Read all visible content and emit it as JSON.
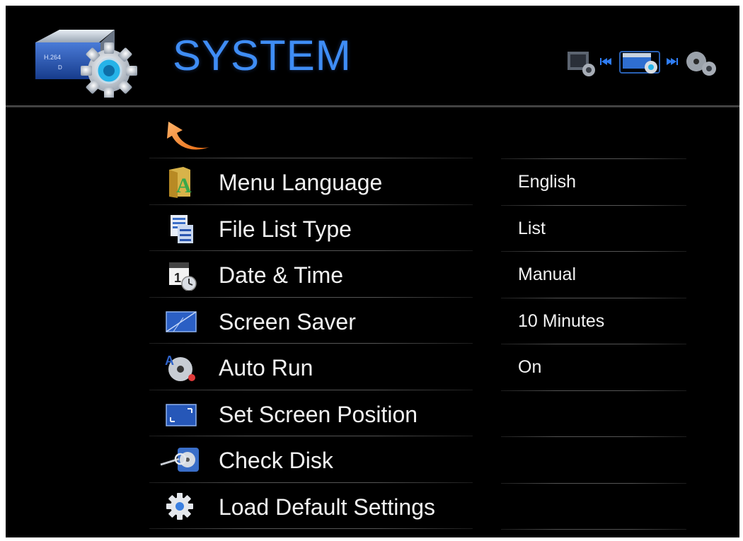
{
  "header": {
    "title": "SYSTEM",
    "app_icon": "system-settings-icon",
    "nav_icons": [
      "video-settings-icon",
      "prev-icon",
      "system-icon",
      "next-icon",
      "disc-settings-icon"
    ]
  },
  "back_icon": "back-arrow-icon",
  "colors": {
    "title": "#3f8df5",
    "background": "#000000",
    "text": "#f2f2f2"
  },
  "menu": {
    "items": [
      {
        "label": "Menu Language",
        "value": "English",
        "icon": "language-icon"
      },
      {
        "label": "File List Type",
        "value": "List",
        "icon": "file-list-icon"
      },
      {
        "label": "Date & Time",
        "value": "Manual",
        "icon": "calendar-clock-icon"
      },
      {
        "label": "Screen Saver",
        "value": "10 Minutes",
        "icon": "screen-saver-icon"
      },
      {
        "label": "Auto Run",
        "value": "On",
        "icon": "auto-run-disc-icon"
      },
      {
        "label": "Set Screen Position",
        "value": "",
        "icon": "screen-position-icon"
      },
      {
        "label": "Check Disk",
        "value": "",
        "icon": "check-disk-icon"
      },
      {
        "label": "Load Default Settings",
        "value": "",
        "icon": "gear-icon"
      }
    ]
  }
}
